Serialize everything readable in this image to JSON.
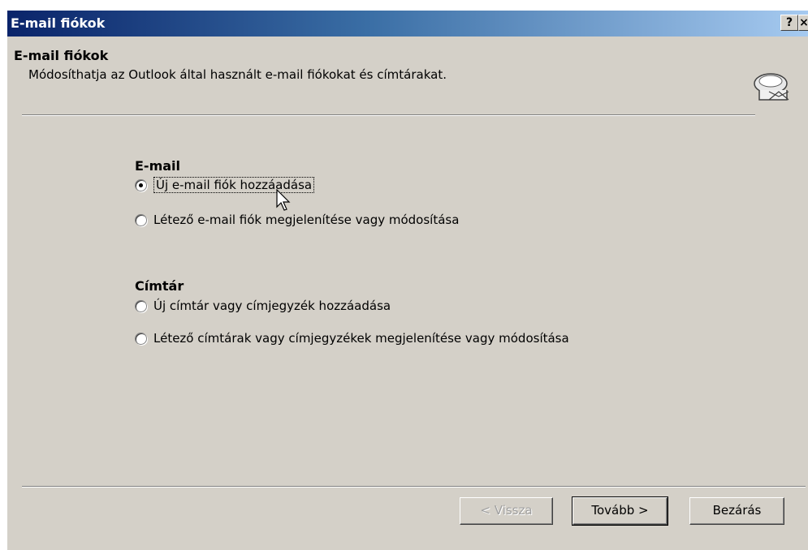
{
  "window": {
    "title": "E-mail fiókok",
    "help_button": "?",
    "close_button": "×"
  },
  "header": {
    "title": "E-mail fiókok",
    "description": "Módosíthatja az Outlook által használt e-mail fiókokat és címtárakat.",
    "icon": "envelope-icon"
  },
  "email_group": {
    "label": "E-mail",
    "options": [
      {
        "label": "Új e-mail fiók hozzáadása",
        "selected": true
      },
      {
        "label": "Létező e-mail fiók megjelenítése vagy módosítása",
        "selected": false
      }
    ]
  },
  "directory_group": {
    "label": "Címtár",
    "options": [
      {
        "label": "Új címtár vagy címjegyzék hozzáadása",
        "selected": false
      },
      {
        "label": "Létező címtárak vagy címjegyzékek megjelenítése vagy módosítása",
        "selected": false
      }
    ]
  },
  "buttons": {
    "back": "< Vissza",
    "next": "Tovább >",
    "close": "Bezárás"
  }
}
